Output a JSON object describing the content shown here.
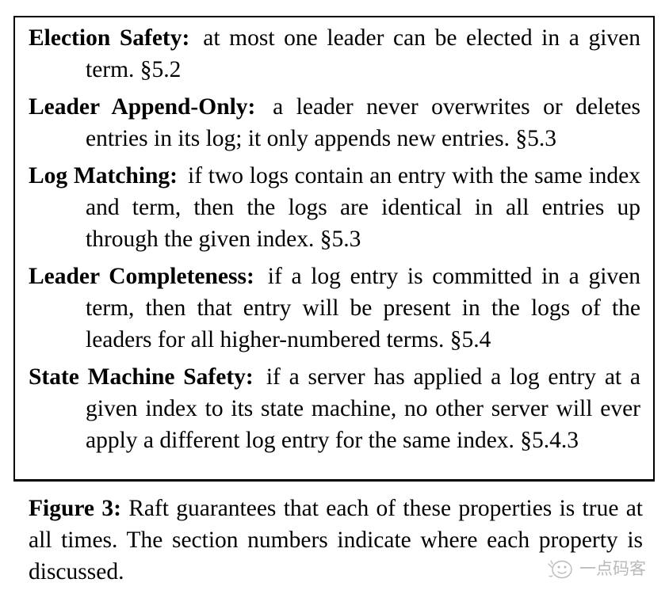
{
  "figure": {
    "box": {
      "properties": [
        {
          "term": "Election Safety:",
          "text": "at most one leader can be elected in a given term. §5.2"
        },
        {
          "term": "Leader Append-Only:",
          "text": "a leader never overwrites or deletes entries in its log; it only appends new entries. §5.3"
        },
        {
          "term": "Log Matching:",
          "text": "if two logs contain an entry with the same index and term, then the logs are identical in all entries up through the given index. §5.3"
        },
        {
          "term": "Leader Completeness:",
          "text": "if a log entry is committed in a given term, then that entry will be present in the logs of the leaders for all higher-numbered terms. §5.4"
        },
        {
          "term": "State Machine Safety:",
          "text": "if a server has applied a log entry at a given index to its state machine, no other server will ever apply a different log entry for the same index. §5.4.3"
        }
      ]
    },
    "caption": {
      "label": "Figure 3:",
      "text": "Raft guarantees that each of these properties is true at all times. The section numbers indicate where each property is discussed."
    },
    "watermark": {
      "text": "一点码客",
      "icon": "smiley-face-icon"
    },
    "colors": {
      "page_background": "#ffffff",
      "text": "#000000",
      "border": "#000000",
      "watermark": "#5b5b5b"
    }
  }
}
